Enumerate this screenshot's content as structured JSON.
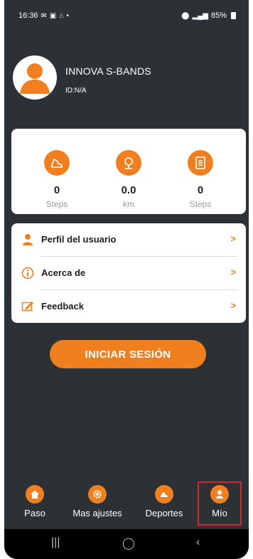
{
  "status_bar": {
    "time": "16:36",
    "battery": "85%",
    "icons_left": [
      "notification-icon",
      "gallery-icon",
      "bag-icon",
      "dot-icon"
    ],
    "icons_right": [
      "location-icon",
      "signal-icon",
      "battery-icon"
    ]
  },
  "profile": {
    "name": "INNOVA S-BANDS",
    "id": "ID:N/A"
  },
  "stats": [
    {
      "value": "0",
      "unit": "Steps",
      "icon": "shoe-icon"
    },
    {
      "value": "0.0",
      "unit": "km",
      "icon": "location-pin-icon"
    },
    {
      "value": "0",
      "unit": "Steps",
      "icon": "list-icon"
    }
  ],
  "menu": [
    {
      "label": "Perfil del usuario",
      "arrow": ">",
      "icon": "user-icon"
    },
    {
      "label": "Acerca de",
      "arrow": ">",
      "icon": "info-icon"
    },
    {
      "label": "Feedback",
      "arrow": ">",
      "icon": "feedback-icon"
    }
  ],
  "login_button": "INICIAR SESIÓN",
  "bottom_nav": [
    {
      "label": "Paso",
      "icon": "home-icon"
    },
    {
      "label": "Mas ajustes",
      "icon": "settings-icon"
    },
    {
      "label": "Deportes",
      "icon": "running-icon"
    },
    {
      "label": "Mío",
      "icon": "person-icon",
      "selected": true
    }
  ],
  "system_nav": {
    "recents": "|||",
    "home": "◯",
    "back": "‹"
  },
  "colors": {
    "accent": "#f07f1f",
    "background": "#2c3135",
    "card": "#ffffff",
    "highlight": "#d42a2a"
  }
}
